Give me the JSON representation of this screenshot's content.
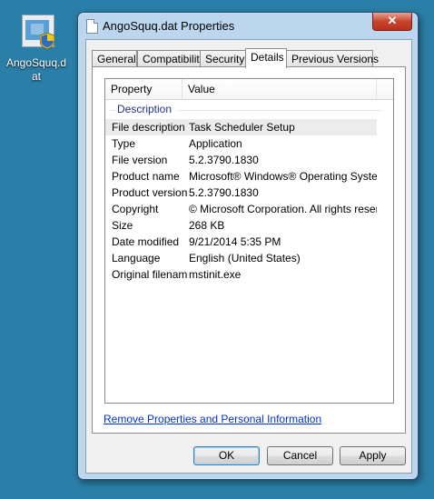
{
  "desktop": {
    "icon_label": "AngoSquq.dat"
  },
  "window": {
    "title": "AngoSquq.dat Properties",
    "close_glyph": "✕"
  },
  "tabs": [
    {
      "label": "General",
      "active": false
    },
    {
      "label": "Compatibility",
      "active": false
    },
    {
      "label": "Security",
      "active": false
    },
    {
      "label": "Details",
      "active": true
    },
    {
      "label": "Previous Versions",
      "active": false
    }
  ],
  "details": {
    "columns": {
      "property": "Property",
      "value": "Value"
    },
    "group": "Description",
    "rows": [
      {
        "key": "File description",
        "value": "Task Scheduler Setup",
        "selected": true
      },
      {
        "key": "Type",
        "value": "Application"
      },
      {
        "key": "File version",
        "value": "5.2.3790.1830"
      },
      {
        "key": "Product name",
        "value": "Microsoft® Windows® Operating System"
      },
      {
        "key": "Product version",
        "value": "5.2.3790.1830"
      },
      {
        "key": "Copyright",
        "value": "© Microsoft Corporation. All rights reserv..."
      },
      {
        "key": "Size",
        "value": "268 KB"
      },
      {
        "key": "Date modified",
        "value": "9/21/2014 5:35 PM"
      },
      {
        "key": "Language",
        "value": "English (United States)"
      },
      {
        "key": "Original filename",
        "value": "mstinit.exe"
      }
    ]
  },
  "link": {
    "remove_props": "Remove Properties and Personal Information"
  },
  "buttons": {
    "ok": "OK",
    "cancel": "Cancel",
    "apply": "Apply"
  }
}
